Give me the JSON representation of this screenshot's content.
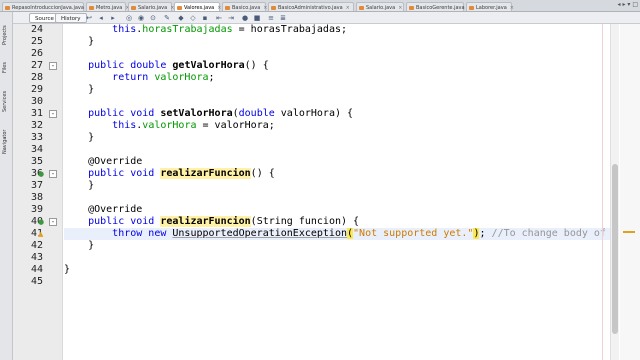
{
  "tabs": [
    {
      "label": "RepasoIntroduccionJava.java",
      "active": false
    },
    {
      "label": "Metro.java",
      "active": false
    },
    {
      "label": "Salario.java",
      "active": false
    },
    {
      "label": "Valores.java",
      "active": true
    },
    {
      "label": "Basico.java",
      "active": false
    },
    {
      "label": "BasicoAdministrativo.java",
      "active": false
    },
    {
      "label": "Salario.java",
      "active": false
    },
    {
      "label": "BasicoGerente.java",
      "active": false
    },
    {
      "label": "Laborer.java",
      "active": false
    }
  ],
  "side_panels": [
    "Projects",
    "Files",
    "Services",
    "Navigator"
  ],
  "toolbar": {
    "source_label": "Source",
    "history_label": "History"
  },
  "code_lines": [
    {
      "num": "24",
      "fold": "",
      "text": "        this.horasTrabajadas = horasTrabajadas;"
    },
    {
      "num": "25",
      "fold": "",
      "text": "    }"
    },
    {
      "num": "26",
      "fold": "",
      "text": ""
    },
    {
      "num": "27",
      "fold": "-",
      "text": "    public double getValorHora() {"
    },
    {
      "num": "28",
      "fold": "",
      "text": "        return valorHora;"
    },
    {
      "num": "29",
      "fold": "",
      "text": "    }"
    },
    {
      "num": "30",
      "fold": "",
      "text": ""
    },
    {
      "num": "31",
      "fold": "-",
      "text": "    public void setValorHora(double valorHora) {"
    },
    {
      "num": "32",
      "fold": "",
      "text": "        this.valorHora = valorHora;"
    },
    {
      "num": "33",
      "fold": "",
      "text": "    }"
    },
    {
      "num": "34",
      "fold": "",
      "text": ""
    },
    {
      "num": "35",
      "fold": "",
      "text": "    @Override"
    },
    {
      "num": "36",
      "fold": "-",
      "text": "    public void realizarFuncion() {"
    },
    {
      "num": "37",
      "fold": "",
      "text": "    }"
    },
    {
      "num": "38",
      "fold": "",
      "text": ""
    },
    {
      "num": "39",
      "fold": "",
      "text": "    @Override"
    },
    {
      "num": "40",
      "fold": "-",
      "text": "    public void realizarFuncion(String funcion) {"
    },
    {
      "num": "41",
      "fold": "",
      "text": "        throw new UnsupportedOperationException(\"Not supported yet.\"); //To change body of gener"
    },
    {
      "num": "42",
      "fold": "",
      "text": "    }"
    },
    {
      "num": "43",
      "fold": "",
      "text": ""
    },
    {
      "num": "44",
      "fold": "",
      "text": "}"
    },
    {
      "num": "45",
      "fold": "",
      "text": ""
    }
  ],
  "tokens": {
    "l24_this": "this",
    "l24_dot": ".",
    "l24_field": "horasTrabajadas",
    "l24_rest": " = horasTrabajadas;",
    "l27_kw": "public double",
    "l27_name": "getValorHora",
    "l27_rest": "() {",
    "l28_kw": "return",
    "l28_field": "valorHora",
    "l28_semi": ";",
    "l31_kw": "public void",
    "l31_name": "setValorHora",
    "l31_open": "(",
    "l31_kw2": "double",
    "l31_rest": " valorHora) {",
    "l32_this": "this",
    "l32_dot": ".",
    "l32_field": "valorHora",
    "l32_rest": " = valorHora;",
    "l35_ann": "@Override",
    "l36_kw": "public void",
    "l36_name": "realizarFuncion",
    "l36_rest": "() {",
    "l39_ann": "@Override",
    "l40_kw": "public void",
    "l40_name": "realizarFuncion",
    "l40_rest": "(String funcion) {",
    "l41_kw": "throw new",
    "l41_cls": "UnsupportedOperationException",
    "l41_open": "(",
    "l41_str": "\"Not supported yet.\"",
    "l41_close": ")",
    "l41_semi": ";",
    "l41_cmt": "//To change body of gener",
    "brace_close": "}",
    "brace_end": "}"
  },
  "gutter_icons": {
    "override_icon_color": "#3c9a3c",
    "warning_icon_color": "#e0a020"
  },
  "colors": {
    "keyword": "#0000e6",
    "field": "#009900",
    "string": "#ce7b00",
    "comment": "#969696",
    "highlight": "#fff1a6"
  }
}
